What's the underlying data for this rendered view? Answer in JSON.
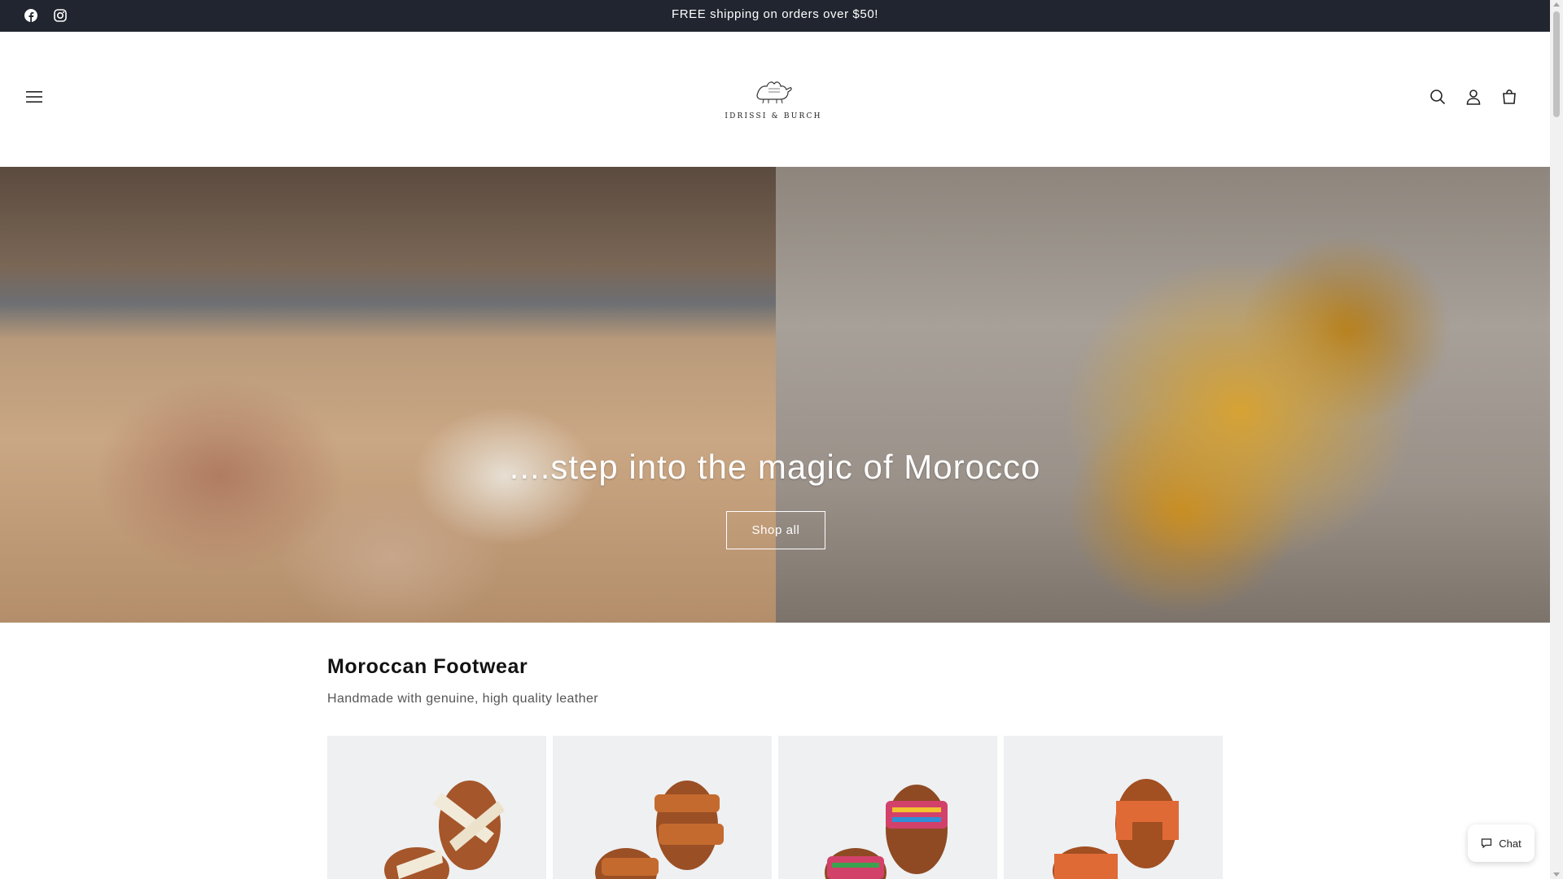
{
  "announcement": {
    "message": "FREE shipping on orders over $50!",
    "social_icons": [
      "facebook-icon",
      "instagram-icon"
    ]
  },
  "header": {
    "menu_icon": "hamburger-icon",
    "logo_text": "IDRISSI & BURCH",
    "icons": [
      "search-icon",
      "account-icon",
      "cart-icon"
    ]
  },
  "hero": {
    "heading": "....step into the magic of Morocco",
    "button_label": "Shop all"
  },
  "collection": {
    "title": "Moroccan Footwear",
    "subtitle": "Handmade with genuine, high quality leather"
  },
  "chat": {
    "label": "Chat"
  },
  "colors": {
    "announcement_bg": "#21252f",
    "text": "#121212",
    "card_bg": "#eef0f2"
  }
}
